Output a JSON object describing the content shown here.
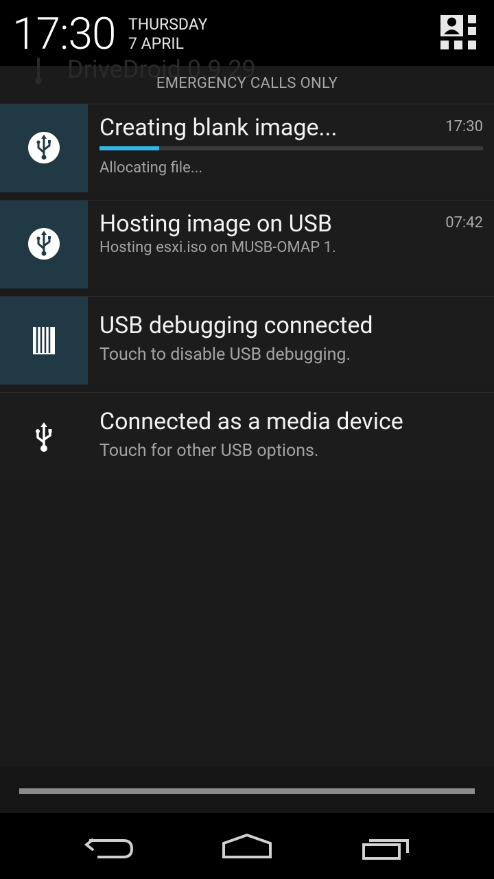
{
  "header": {
    "time": "17:30",
    "day": "THURSDAY",
    "date": "7 APRIL"
  },
  "ghost_app_name": "DriveDroid 0.9.29",
  "status": {
    "emergency": "EMERGENCY CALLS ONLY"
  },
  "notifications": [
    {
      "title": "Creating blank image...",
      "time": "17:30",
      "subtitle": "Allocating file...",
      "progress": 0.155,
      "icon": "usb-icon"
    },
    {
      "title": "Hosting image on USB",
      "time": "07:42",
      "subtitle": "Hosting esxi.iso on MUSB-OMAP 1.",
      "icon": "usb-icon"
    },
    {
      "title": "USB debugging connected",
      "subtitle": "Touch to disable USB debugging.",
      "icon": "android-debug-icon"
    },
    {
      "title": "Connected as a media device",
      "subtitle": "Touch for other USB options.",
      "icon": "usb-icon"
    }
  ],
  "colors": {
    "accent": "#33b5e5",
    "icon_bg": "#213845"
  },
  "nav": {
    "back": "back-icon",
    "home": "home-icon",
    "recents": "recents-icon"
  }
}
